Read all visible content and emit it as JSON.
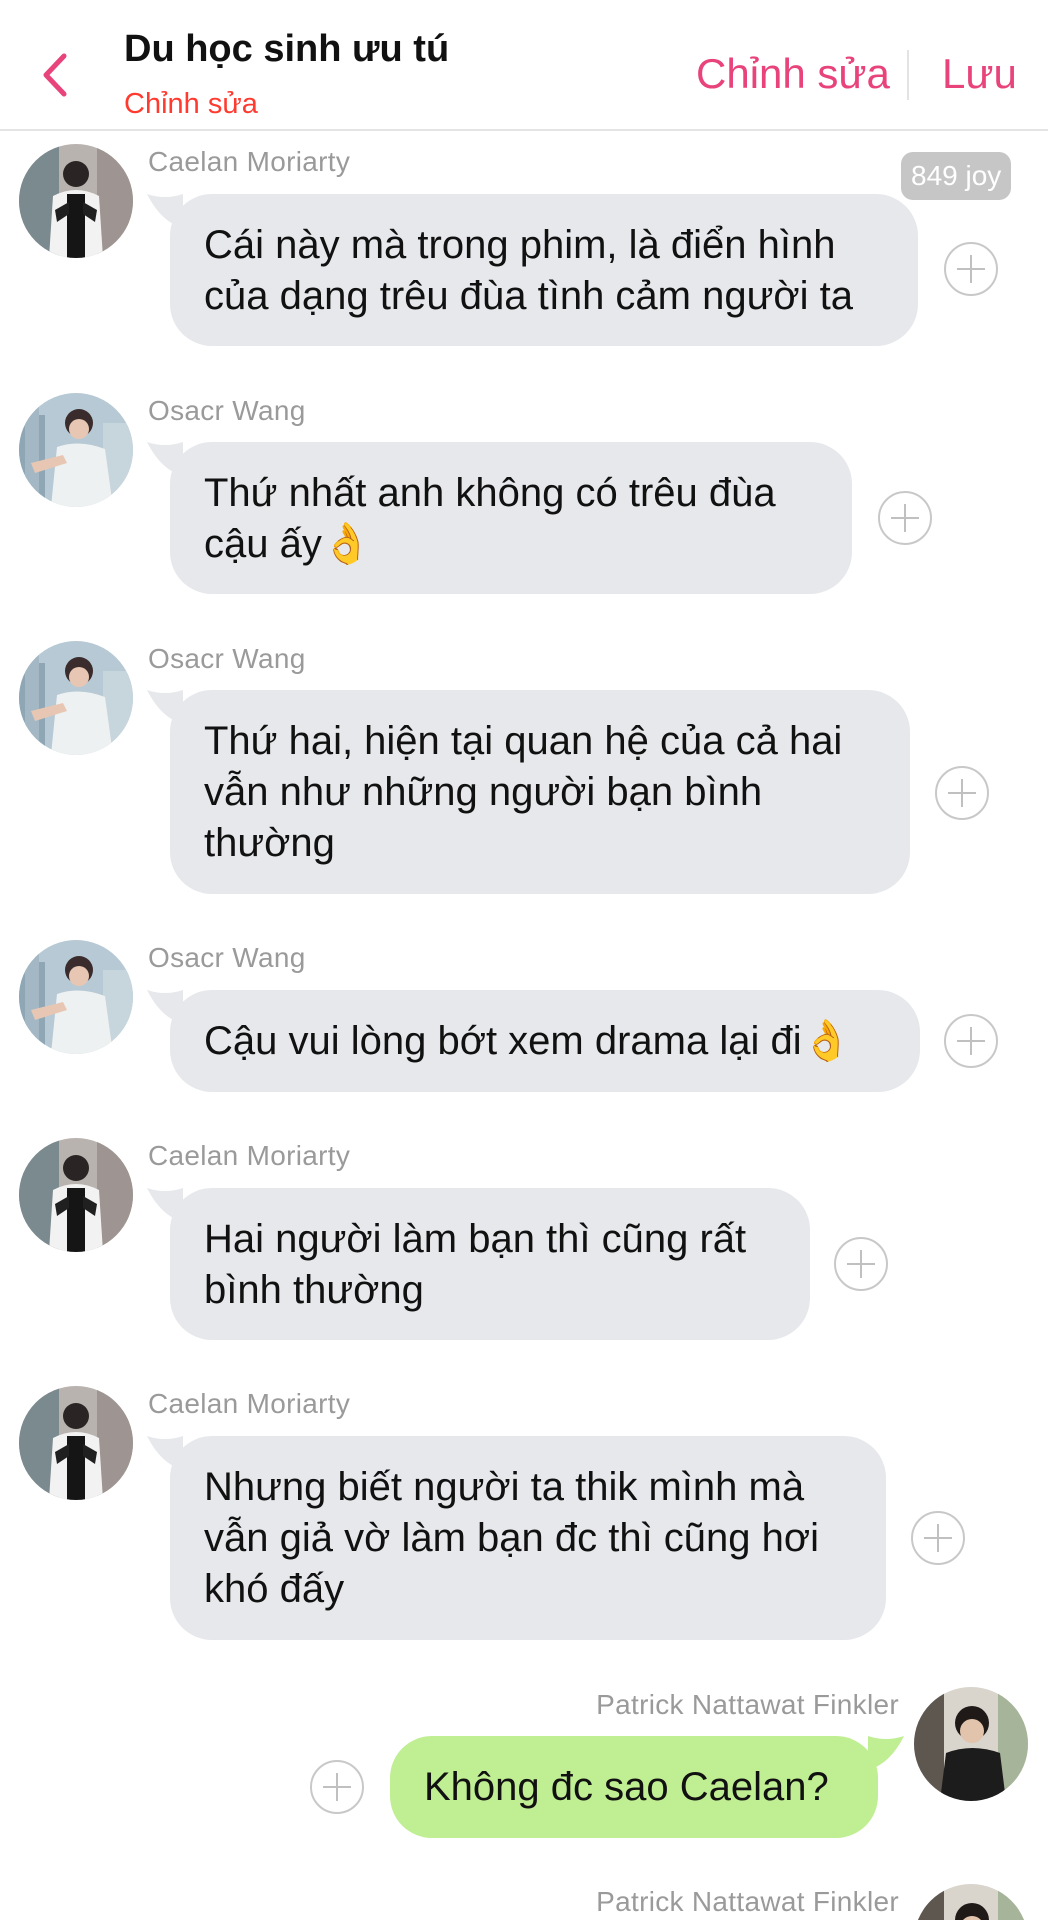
{
  "header": {
    "title": "Du học sinh ưu tú",
    "subtitle": "Chỉnh sửa",
    "edit_label": "Chỉnh sửa",
    "save_label": "Lưu",
    "accent_color": "#e8437a"
  },
  "joy_badge": "849 joy",
  "messages": [
    {
      "sender": "Caelan Moriarty",
      "text": "Cái này mà trong phim, là điển hình của dạng trêu đùa tình cảm người ta",
      "side": "left",
      "avatar": "caelan-avatar"
    },
    {
      "sender": "Osacr Wang",
      "text": "Thứ nhất anh không có trêu đùa cậu ấy👌",
      "side": "left",
      "avatar": "oscar-avatar"
    },
    {
      "sender": "Osacr Wang",
      "text": "Thứ hai, hiện tại quan hệ của cả hai vẫn như những người bạn bình thường",
      "side": "left",
      "avatar": "oscar-avatar"
    },
    {
      "sender": "Osacr Wang",
      "text": "Cậu vui lòng bớt xem drama lại đi👌",
      "side": "left",
      "avatar": "oscar-avatar"
    },
    {
      "sender": "Caelan Moriarty",
      "text": "Hai người làm bạn thì cũng rất bình thường",
      "side": "left",
      "avatar": "caelan-avatar"
    },
    {
      "sender": "Caelan Moriarty",
      "text": "Nhưng biết người ta thik mình mà vẫn giả vờ làm bạn đc thì cũng hơi khó đấy",
      "side": "left",
      "avatar": "caelan-avatar"
    },
    {
      "sender": "Patrick Nattawat Finkler",
      "text": "Không đc sao Caelan?",
      "side": "right",
      "avatar": "patrick-avatar"
    },
    {
      "sender": "Patrick Nattawat Finkler",
      "text": "",
      "side": "right",
      "avatar": "patrick-avatar"
    }
  ],
  "colors": {
    "incoming_bubble": "#e6e8eb",
    "outgoing_bubble": "#c0ee92",
    "sender_name": "#9a9a9a",
    "subtitle": "#ff3b30"
  }
}
